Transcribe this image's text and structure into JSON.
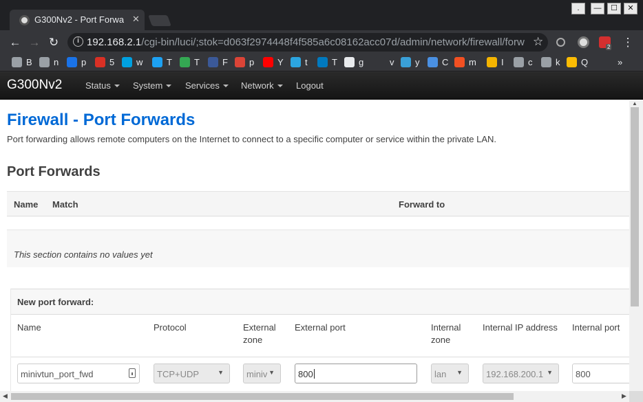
{
  "browser": {
    "tab_title": "G300Nv2 - Port Forwa",
    "tab_close": "✕",
    "url_host": "192.168.2.1",
    "url_path": "/cgi-bin/luci/;stok=d063f2974448f4f585a6c08162acc07d/admin/network/firewall/forw",
    "min_label": "—",
    "max_label": "☐",
    "close_label": "✕",
    "dot_label": ".",
    "ext_badge": "2"
  },
  "bookmarks": [
    {
      "label": "B",
      "icon": "star-icon",
      "color": "#9aa0a6"
    },
    {
      "label": "n",
      "icon": "folder-icon",
      "color": "#9aa0a6"
    },
    {
      "label": "p",
      "icon": "oc-icon",
      "color": "#1a73e8"
    },
    {
      "label": "5",
      "icon": "stamp-icon",
      "color": "#d93025"
    },
    {
      "label": "w",
      "icon": "d-icon",
      "color": "#00a0e0"
    },
    {
      "label": "T",
      "icon": "twitter-icon",
      "color": "#1da1f2"
    },
    {
      "label": "T",
      "icon": "tree-icon",
      "color": "#34a853"
    },
    {
      "label": "F",
      "icon": "facebook-icon",
      "color": "#3b5998"
    },
    {
      "label": "p",
      "icon": "google-plus-icon",
      "color": "#db4437"
    },
    {
      "label": "Y",
      "icon": "youtube-icon",
      "color": "#ff0000"
    },
    {
      "label": "t",
      "icon": "telegram-icon",
      "color": "#2ca5e0"
    },
    {
      "label": "T",
      "icon": "trello-icon",
      "color": "#0079bf"
    },
    {
      "label": "g",
      "icon": "github-icon",
      "color": "#e8eaed"
    },
    {
      "label": "v",
      "icon": "blank-icon",
      "color": "#35363a"
    },
    {
      "label": "y",
      "icon": "globe-icon",
      "color": "#3aa0d8"
    },
    {
      "label": "C",
      "icon": "infinity-icon",
      "color": "#4a90e2"
    },
    {
      "label": "m",
      "icon": "windows-icon",
      "color": "#f25022"
    },
    {
      "label": "I",
      "icon": "sun-icon",
      "color": "#f4b400"
    },
    {
      "label": "c",
      "icon": "page-icon",
      "color": "#9aa0a6"
    },
    {
      "label": "k",
      "icon": "page-icon",
      "color": "#9aa0a6"
    },
    {
      "label": "Q",
      "icon": "star-yellow-icon",
      "color": "#fbbc04"
    }
  ],
  "bookmarks_more": "»",
  "nav": {
    "brand": "G300Nv2",
    "items": [
      "Status",
      "System",
      "Services",
      "Network",
      "Logout"
    ]
  },
  "page": {
    "title": "Firewall - Port Forwards",
    "description": "Port forwarding allows remote computers on the Internet to connect to a specific computer or service within the private LAN.",
    "section_title": "Port Forwards",
    "table_headers": [
      "Name",
      "Match",
      "Forward to"
    ],
    "empty_text": "This section contains no values yet"
  },
  "new_forward": {
    "heading": "New port forward:",
    "labels": {
      "name": "Name",
      "protocol": "Protocol",
      "external_zone": "External zone",
      "external_port": "External port",
      "internal_zone": "Internal zone",
      "internal_ip": "Internal IP address",
      "internal_port": "Internal port"
    },
    "values": {
      "name": "minivtun_port_fwd",
      "protocol": "TCP+UDP",
      "external_zone": "miniv",
      "external_port": "800",
      "internal_zone": "lan",
      "internal_ip": "192.168.200.1",
      "internal_port": "800"
    }
  },
  "colors": {
    "accent": "#0069d6",
    "navbar": "#1b1b1b"
  }
}
